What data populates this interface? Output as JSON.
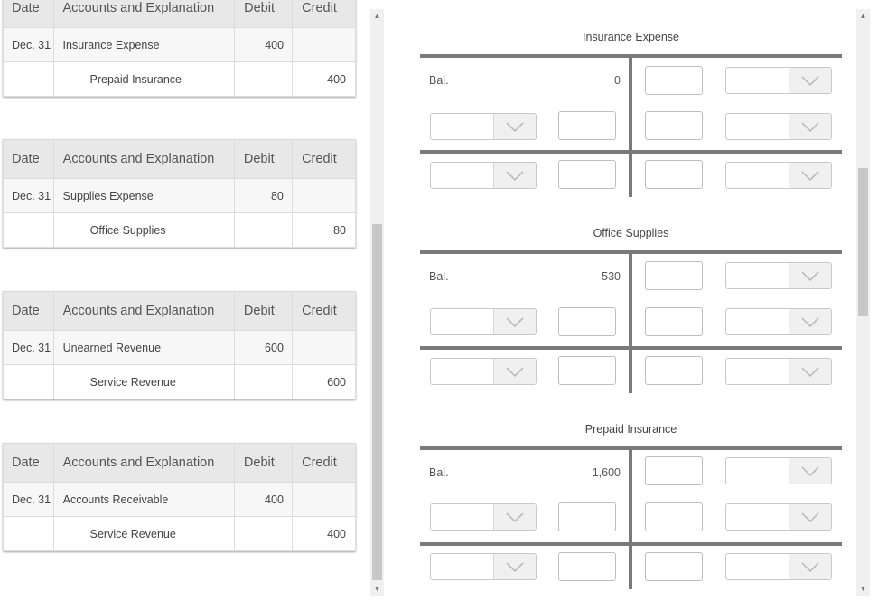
{
  "table_header": {
    "date": "Date",
    "account": "Accounts and Explanation",
    "debit": "Debit",
    "credit": "Credit"
  },
  "entries": [
    {
      "date": "Dec. 31",
      "debit_account": "Insurance Expense",
      "debit": "400",
      "credit_account": "Prepaid Insurance",
      "credit": "400"
    },
    {
      "date": "Dec. 31",
      "debit_account": "Supplies Expense",
      "debit": "80",
      "credit_account": "Office Supplies",
      "credit": "80"
    },
    {
      "date": "Dec. 31",
      "debit_account": "Unearned Revenue",
      "debit": "600",
      "credit_account": "Service Revenue",
      "credit": "600"
    },
    {
      "date": "Dec. 31",
      "debit_account": "Accounts Receivable",
      "debit": "400",
      "credit_account": "Service Revenue",
      "credit": "400"
    }
  ],
  "taccounts": [
    {
      "title": "Insurance Expense",
      "bal_label": "Bal.",
      "bal_value": "0"
    },
    {
      "title": "Office Supplies",
      "bal_label": "Bal.",
      "bal_value": "530"
    },
    {
      "title": "Prepaid Insurance",
      "bal_label": "Bal.",
      "bal_value": "1,600"
    }
  ],
  "icons": {
    "dropdown": "chevron-down-icon",
    "scroll_up": "triangle-up-icon",
    "scroll_down": "triangle-down-icon"
  },
  "colors": {
    "header_bg": "#e8e8e8",
    "tbar": "#7a7a7a",
    "border": "#dcdcdc"
  }
}
